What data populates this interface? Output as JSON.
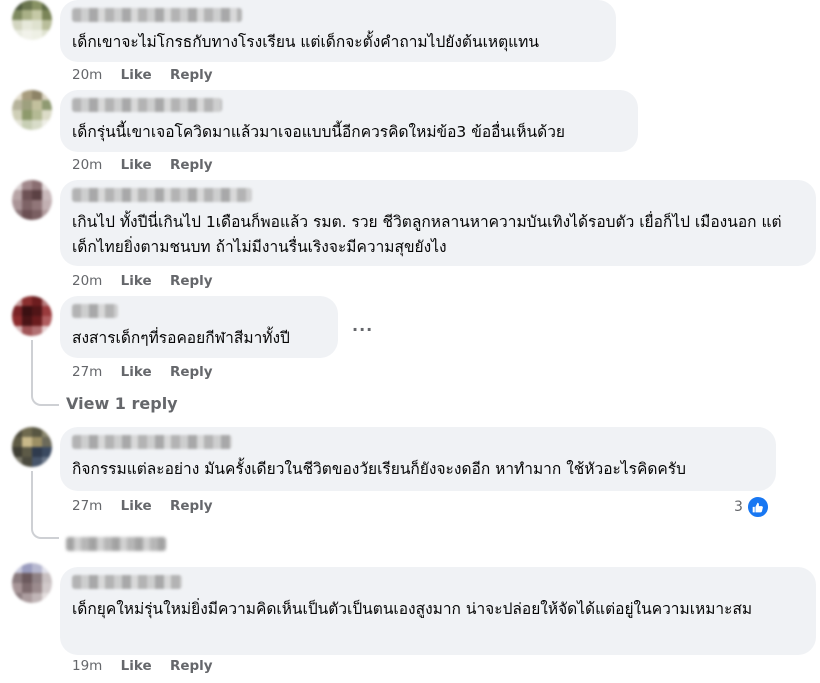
{
  "comments": [
    {
      "text": "เด็กเขาจะไม่โกรธกับทางโรงเรียน แต่เด็กจะตั้งคำถามไปยังต้นเหตุแทน",
      "time": "20m",
      "like": "Like",
      "reply": "Reply"
    },
    {
      "name": "nong Shirinamo.",
      "text": "เด็กรุ่นนี้เขาเจอโควิดมาแล้วมาเจอแบบนี้อีกควรคิดใหม่ข้อ3 ข้ออื่นเห็นด้วย",
      "time": "20m",
      "like": "Like",
      "reply": "Reply"
    },
    {
      "name": "Thailnee Sugannpiyapun",
      "text": "เกินไป ทั้งปีนี่เกินไป 1เดือนก็พอแล้ว รมต. รวย ชีวิตลูกหลานหาความบันเทิงได้รอบตัว เยื่อก็ไป เมืองนอก แต่เด็กไทยยิ่งตามชนบท ถ้าไม่มีงานรื่นเริงจะมีความสุขยังไง",
      "time": "20m",
      "like": "Like",
      "reply": "Reply"
    },
    {
      "name": "T NG",
      "text": "สงสารเด็กๆที่รอคอยกีฬาสีมาทั้งปี",
      "time": "27m",
      "like": "Like",
      "reply": "Reply",
      "more": "...",
      "view_replies": "View 1 reply"
    },
    {
      "text": "กิจกรรมแต่ละอย่าง มันครั้งเดียวในชีวิตของวัยเรียนก็ยังจะงดอีก หาทำมาก ใช้หัวอะไรคิดครับ",
      "time": "27m",
      "like": "Like",
      "reply": "Reply",
      "reaction_count": "3",
      "view_replies": "View 1 reply"
    },
    {
      "text": "เด็กยุคใหม่รุ่นใหม่ยิ่งมีความคิดเห็นเป็นตัวเป็นตนเองสูงมาก น่าจะปล่อยให้จัดได้แต่อยู่ในความเหมาะสม",
      "time": "19m",
      "like": "Like",
      "reply": "Reply"
    }
  ],
  "colors": {
    "bubble": "#f0f2f5",
    "meta": "#65676b",
    "like_blue": "#1877f2"
  },
  "icons": {
    "reaction": "thumbs-up-icon",
    "more": "more-options-icon"
  }
}
